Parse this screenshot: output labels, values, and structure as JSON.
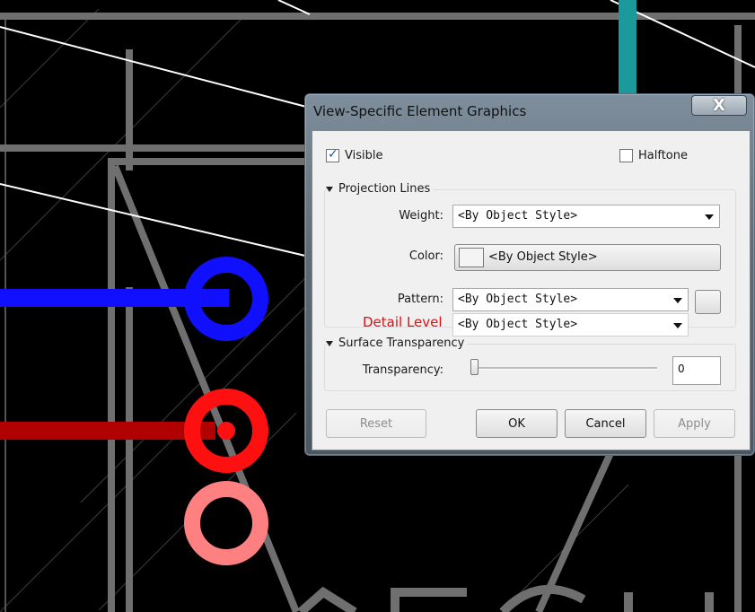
{
  "dialog": {
    "title": "View-Specific Element Graphics",
    "close_glyph": "X",
    "visible_label": "Visible",
    "visible_checked": true,
    "halftone_label": "Halftone",
    "halftone_checked": false,
    "projection_lines": {
      "header": "Projection Lines",
      "weight_label": "Weight:",
      "weight_value": "<By Object Style>",
      "color_label": "Color:",
      "color_value": "<By Object Style>",
      "pattern_label": "Pattern:",
      "pattern_value": "<By Object Style>",
      "pattern_browse_label": "..."
    },
    "detail_level_value": "<By Object Style>",
    "surface_transparency": {
      "header": "Surface Transparency",
      "transparency_label": "Transparency:",
      "transparency_value": "0",
      "slider_fraction": 0
    },
    "buttons": {
      "reset": "Reset",
      "ok": "OK",
      "cancel": "Cancel",
      "apply": "Apply"
    }
  },
  "overlay_annotation": "Detail Level",
  "colors": {
    "background": "#000000",
    "grid_gray": "#6f6f6f",
    "teal": "#1a9a9a",
    "blue": "#1010ff",
    "red": "#ff1010",
    "dark_red": "#b00000",
    "pink": "#ff8080",
    "annotation_red": "#e01010"
  },
  "icons": [
    "checkbox-checked-icon",
    "checkbox-empty-icon",
    "collapse-triangle-icon",
    "dropdown-arrow-icon",
    "close-icon"
  ]
}
